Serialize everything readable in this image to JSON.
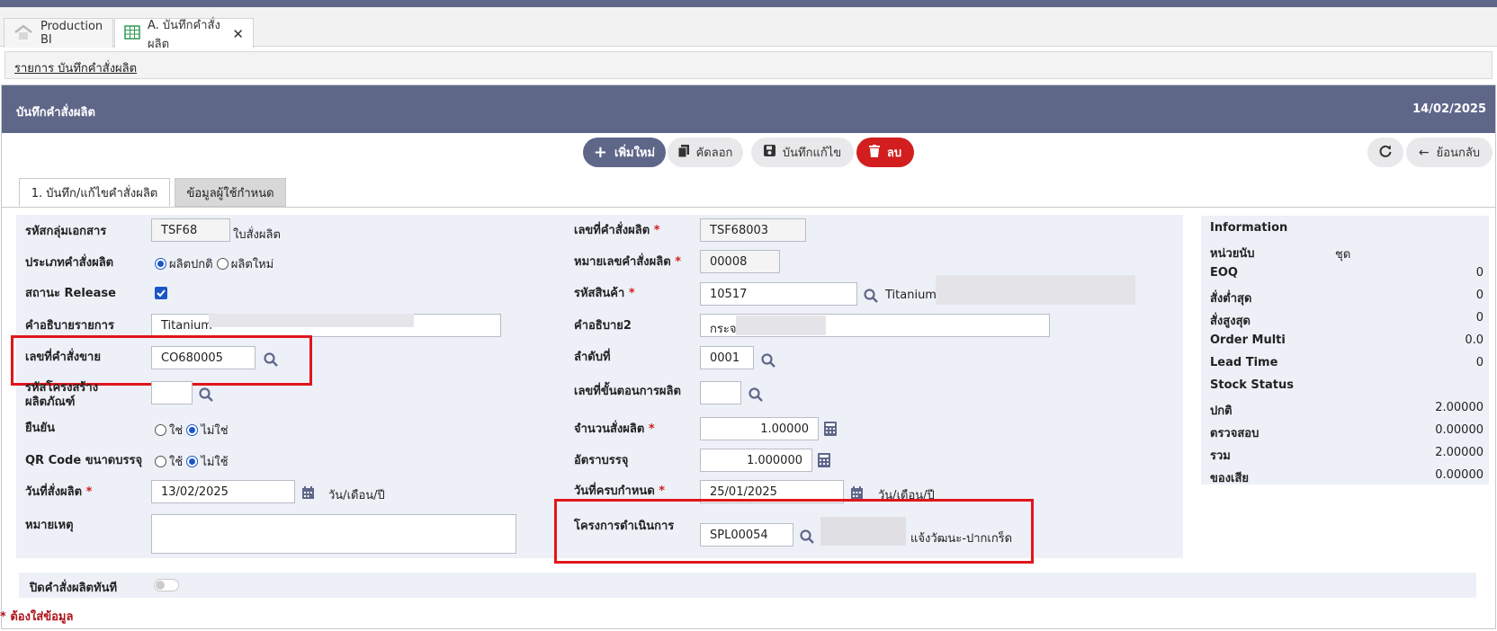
{
  "tabs": [
    {
      "label": "Production BI",
      "icon": "home-icon"
    },
    {
      "label": "A. บันทึกคำสั่งผลิต",
      "icon": "table-icon",
      "close": "✕"
    }
  ],
  "breadcrumb": "รายการ บันทึกคำสั่งผลิต",
  "panel": {
    "title": "บันทึกคำสั่งผลิต",
    "date": "14/02/2025"
  },
  "toolbar": {
    "add_label": "เพิ่มใหม่",
    "copy_label": "คัดลอก",
    "save_label": "บันทึกแก้ไข",
    "delete_label": "ลบ",
    "back_label": "ย้อนกลับ"
  },
  "form_tabs": [
    "1. บันทึก/แก้ไขคำสั่งผลิต",
    "ข้อมูลผู้ใช้กำหนด"
  ],
  "left": {
    "doc_group": {
      "label": "รหัสกลุ่มเอกสาร",
      "value": "TSF68",
      "suffix": "ใบสั่งผลิต"
    },
    "order_type": {
      "label": "ประเภทคำสั่งผลิต",
      "opt1": "ผลิตปกติ",
      "opt2": "ผลิตใหม่",
      "selected": "ผลิตปกติ"
    },
    "release": {
      "label": "สถานะ Release",
      "checked": true
    },
    "description": {
      "label": "คำอธิบายรายการ",
      "value": "Titanium"
    },
    "sales_order": {
      "label": "เลขที่คำสั่งขาย",
      "value": "CO680005"
    },
    "structure": {
      "label": "รหัสโครงสร้าง ผลิตภัณฑ์",
      "value": ""
    },
    "confirm": {
      "label": "ยืนยัน",
      "opt1": "ใช่",
      "opt2": "ไม่ใช่",
      "selected": "ไม่ใช่"
    },
    "qr": {
      "label": "QR Code ขนาดบรรจุ",
      "opt1": "ใช้",
      "opt2": "ไม่ใช้",
      "selected": "ไม่ใช้"
    },
    "order_date": {
      "label": "วันที่สั่งผลิต",
      "value": "13/02/2025",
      "hint": "วัน/เดือน/ปี"
    },
    "remark": {
      "label": "หมายเหตุ",
      "value": ""
    }
  },
  "right": {
    "order_no": {
      "label": "เลขที่คำสั่งผลิต",
      "value": "TSF68003"
    },
    "order_seq": {
      "label": "หมายเลขคำสั่งผลิต",
      "value": "00008"
    },
    "product": {
      "label": "รหัสสินค้า",
      "value": "10517",
      "desc": "Titanium"
    },
    "desc2": {
      "label": "คำอธิบาย2",
      "value": "กระจ"
    },
    "seq": {
      "label": "ลำดับที่",
      "value": "0001"
    },
    "step": {
      "label": "เลขที่ขั้นตอนการผลิต",
      "value": ""
    },
    "qty": {
      "label": "จำนวนสั่งผลิต",
      "value": "1.00000"
    },
    "pack_rate": {
      "label": "อัตราบรรจุ",
      "value": "1.000000"
    },
    "due_date": {
      "label": "วันที่ครบกำหนด",
      "value": "25/01/2025",
      "hint": "วัน/เดือน/ปี"
    },
    "project": {
      "label": "โครงการดำเนินการ",
      "value": "SPL00054",
      "desc": "แจ้งวัฒนะ-ปากเกร็ด"
    }
  },
  "info": {
    "title": "Information",
    "rows": [
      {
        "label": "หน่วยนับ",
        "value": "ชุด"
      },
      {
        "label": "EOQ",
        "value": "0"
      },
      {
        "label": "สั่งต่ำสุด",
        "value": "0"
      },
      {
        "label": "สั่งสูงสุด",
        "value": "0"
      },
      {
        "label": "Order Multi",
        "value": "0.0"
      },
      {
        "label": "Lead Time",
        "value": "0"
      },
      {
        "label": "Stock Status",
        "value": ""
      },
      {
        "label": "ปกติ",
        "value": "2.00000"
      },
      {
        "label": "ตรวจสอบ",
        "value": "0.00000"
      },
      {
        "label": "รวม",
        "value": "2.00000"
      },
      {
        "label": "ของเสีย",
        "value": "0.00000"
      }
    ]
  },
  "close_now": {
    "label": "ปิดคำสั่งผลิตทันที",
    "on": false
  },
  "footnote": "* ต้องใส่ข้อมูล",
  "colors": {
    "header": "#5f6789",
    "danger": "#d21e1e",
    "highlight": "#e0161b"
  }
}
